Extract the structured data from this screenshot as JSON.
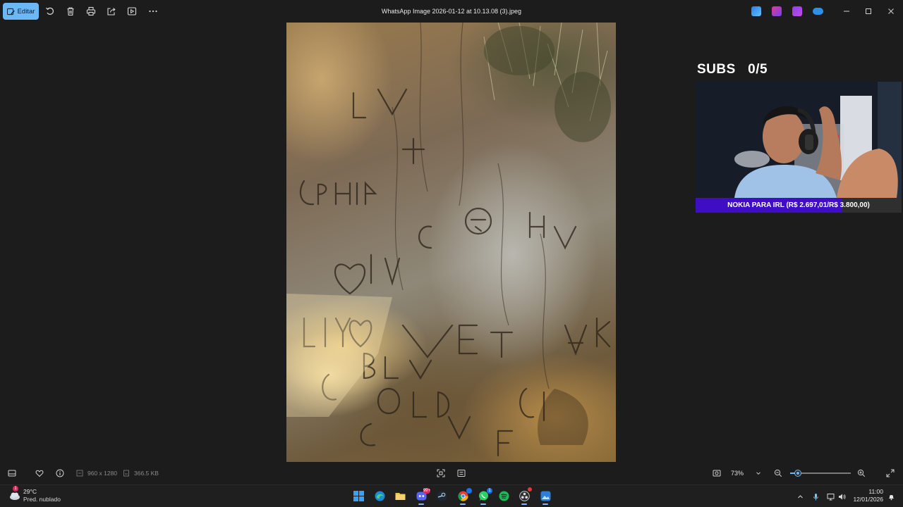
{
  "titlebar": {
    "edit_label": "Editar",
    "file_title": "WhatsApp Image 2026-01-12 at 10.13.08 (3).jpeg"
  },
  "icons": {
    "edit": "pencil-image-icon",
    "rotate": "rotate-icon",
    "delete": "trash-icon",
    "print": "print-icon",
    "share": "share-icon",
    "slideshow": "slideshow-icon",
    "more": "more-icon"
  },
  "overlay": {
    "subs_label": "SUBS",
    "subs_count": "0/5",
    "goal_text": "NOKIA PARA IRL (R$ 2.697,01/R$ 3.800,00)",
    "goal_progress": 0.71,
    "goal_color": "#3f0ec4"
  },
  "bottombar": {
    "dimensions": "960 x 1280",
    "file_size": "366.5 KB",
    "zoom": "73%",
    "zoom_level": 0.13
  },
  "taskbar": {
    "weather_temp": "29°C",
    "weather_desc": "Pred. nublado",
    "weather_badge": "1",
    "discord_badge": "99+",
    "chrome_badge": "",
    "whatsapp_badge": "1",
    "time": "11:00",
    "date": "12/01/2026"
  },
  "colors": {
    "accent": "#6cb8f6",
    "background": "#1c1c1c"
  }
}
